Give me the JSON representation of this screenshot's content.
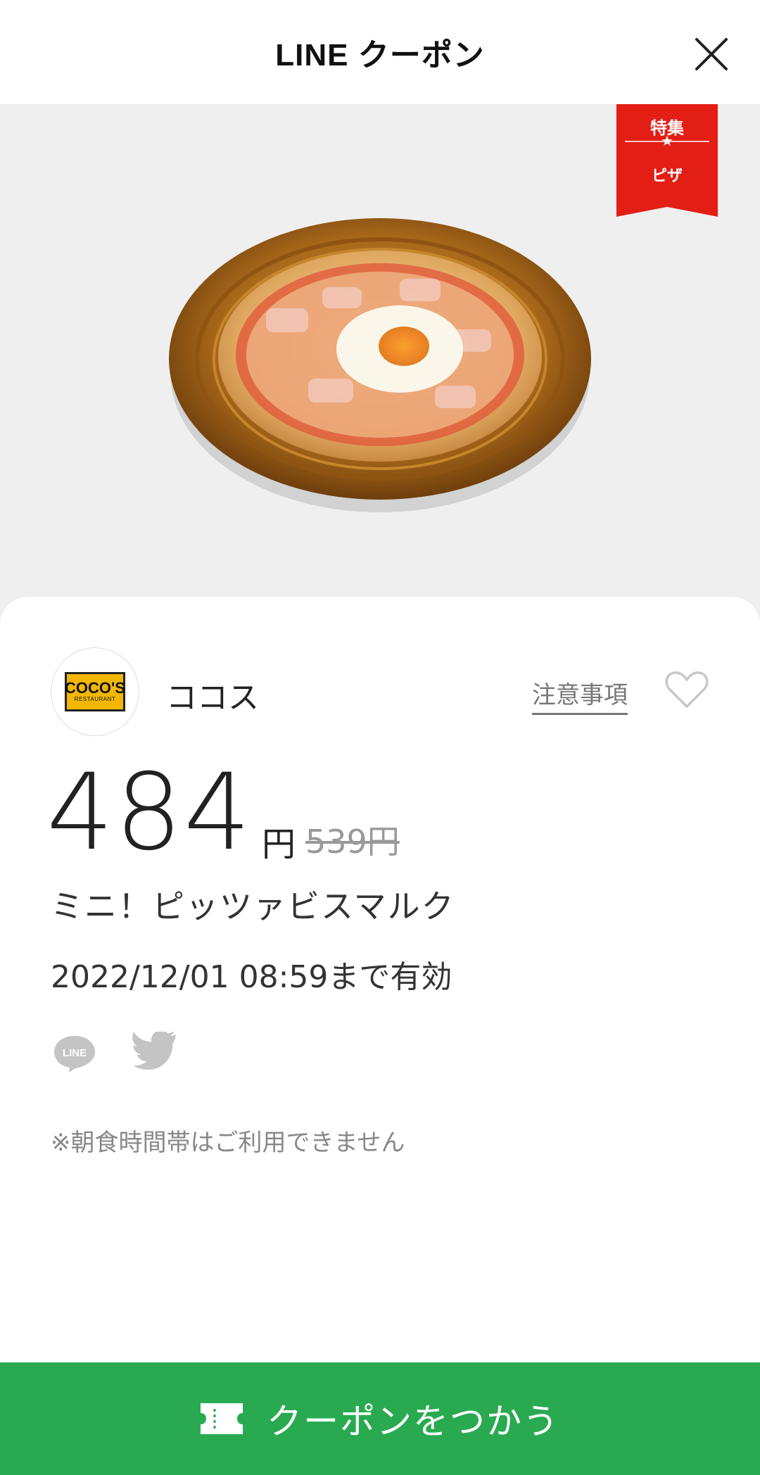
{
  "header": {
    "title": "LINE クーポン",
    "close_icon": "close-icon"
  },
  "hero": {
    "image": "pizza-bismarck-photo",
    "ribbon": {
      "top": "特集",
      "star": "★",
      "bottom": "ピザ",
      "color": "#e31e14"
    }
  },
  "shop": {
    "logo_main": "COCO'S",
    "logo_sub": "RESTAURANT",
    "name": "ココス",
    "notes_label": "注意事項",
    "favorite_icon": "heart-icon"
  },
  "coupon": {
    "price": "484",
    "price_unit": "円",
    "original_price": "539円",
    "item_name": "ミニ！ピッツァビスマルク",
    "expiry": "2022/12/01 08:59まで有効",
    "note": "※朝食時間帯はご利用できません"
  },
  "share": {
    "line_label": "LINE",
    "twitter_icon": "twitter-icon"
  },
  "action": {
    "label": "クーポンをつかう",
    "color": "#2aaa50",
    "icon": "ticket-icon"
  }
}
